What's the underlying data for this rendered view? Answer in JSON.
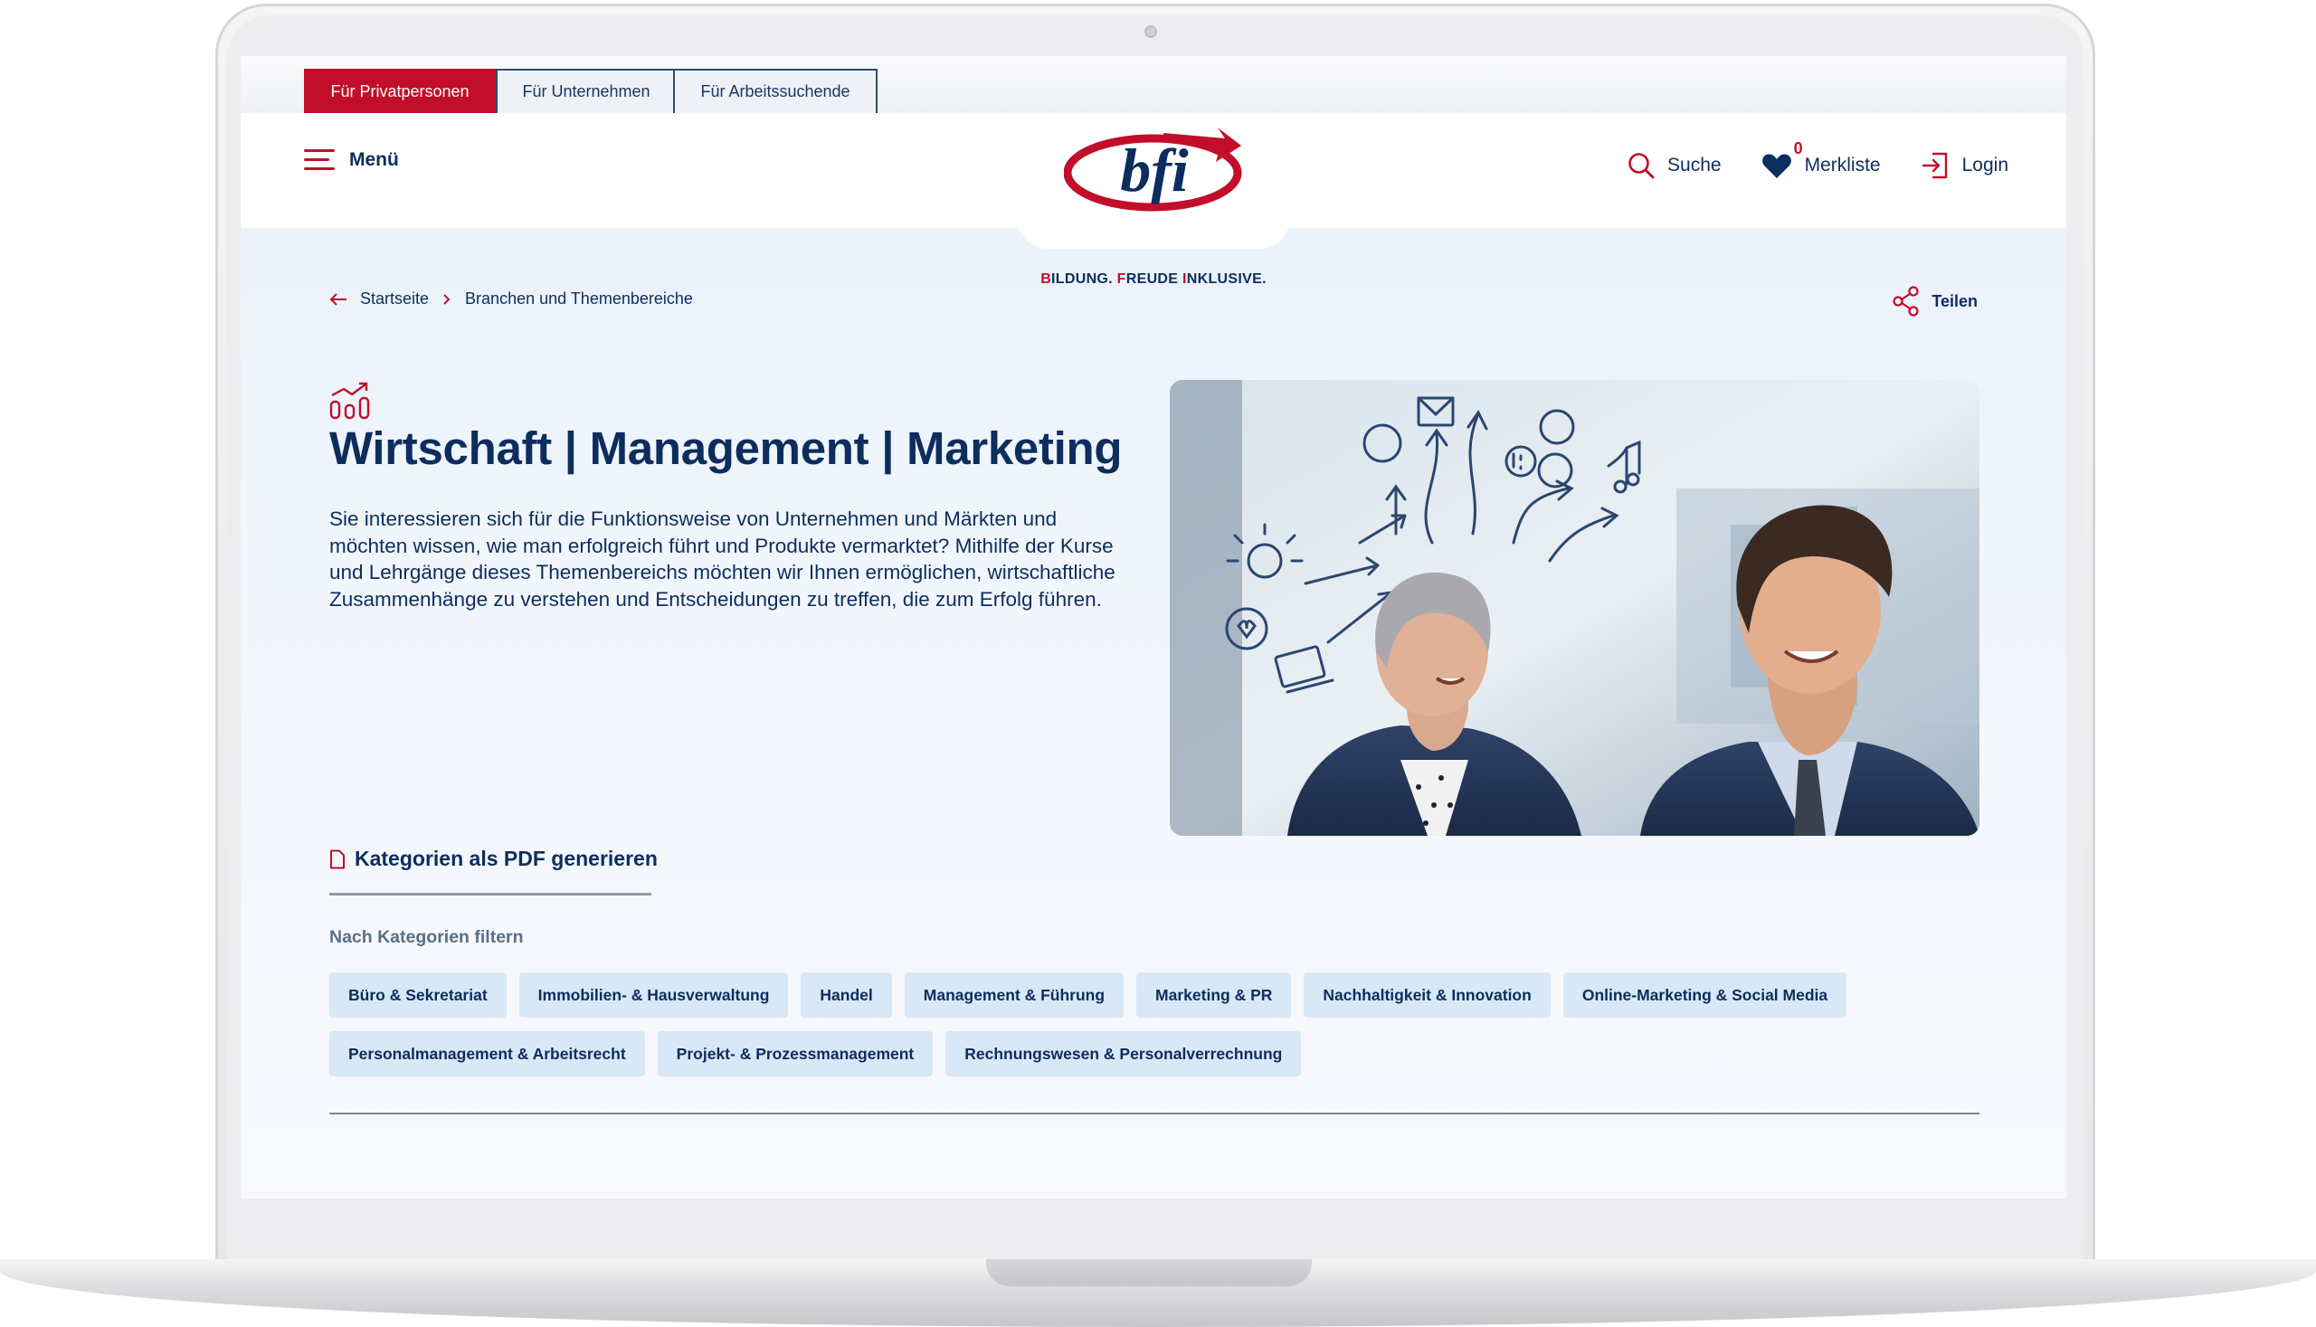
{
  "audience_tabs": [
    {
      "label": "Für Privatpersonen",
      "active": true
    },
    {
      "label": "Für Unternehmen",
      "active": false
    },
    {
      "label": "Für Arbeitssuchende",
      "active": false
    }
  ],
  "header": {
    "menu_label": "Menü",
    "logo_text": "bfi",
    "tagline_parts": [
      "B",
      "ILDUNG. ",
      "F",
      "REUDE ",
      "I",
      "NKLUSIVE."
    ],
    "search_label": "Suche",
    "wishlist_label": "Merkliste",
    "wishlist_count": "0",
    "login_label": "Login"
  },
  "breadcrumb": {
    "home": "Startseite",
    "current": "Branchen und Themenbereiche"
  },
  "share_label": "Teilen",
  "hero": {
    "title": "Wirtschaft | Management | Marketing",
    "intro": "Sie interessieren sich für die Funktionsweise von Unternehmen und Märkten und möchten wissen, wie man erfolgreich führt und Produkte vermarktet? Mithilfe der Kurse und Lehrgänge dieses Themenbereichs möchten wir Ihnen ermöglichen, wirtschaftliche Zusammenhänge zu verstehen und Entscheidungen zu treffen, die zum Erfolg führen.",
    "image_icon": "business-people-ideas-illustration"
  },
  "pdf_link": "Kategorien als PDF generieren",
  "filter_label": "Nach Kategorien filtern",
  "categories_row1": [
    "Büro & Sekretariat",
    "Immobilien- & Hausverwaltung",
    "Handel",
    "Management & Führung",
    "Marketing & PR",
    "Nachhaltigkeit & Innovation",
    "Online-Marketing & Social Media"
  ],
  "categories_row2": [
    "Personalmanagement & Arbeitsrecht",
    "Projekt- & Prozessmanagement",
    "Rechnungswesen & Personalverrechnung"
  ],
  "colors": {
    "brand_red": "#c20e2a",
    "brand_navy": "#0d2d5e",
    "chip_bg": "#d8e8f6"
  },
  "icons": [
    "burger-menu-icon",
    "search-icon",
    "heart-icon",
    "login-icon",
    "arrow-left-icon",
    "chevron-right-icon",
    "share-icon",
    "chart-growth-icon",
    "document-icon"
  ]
}
